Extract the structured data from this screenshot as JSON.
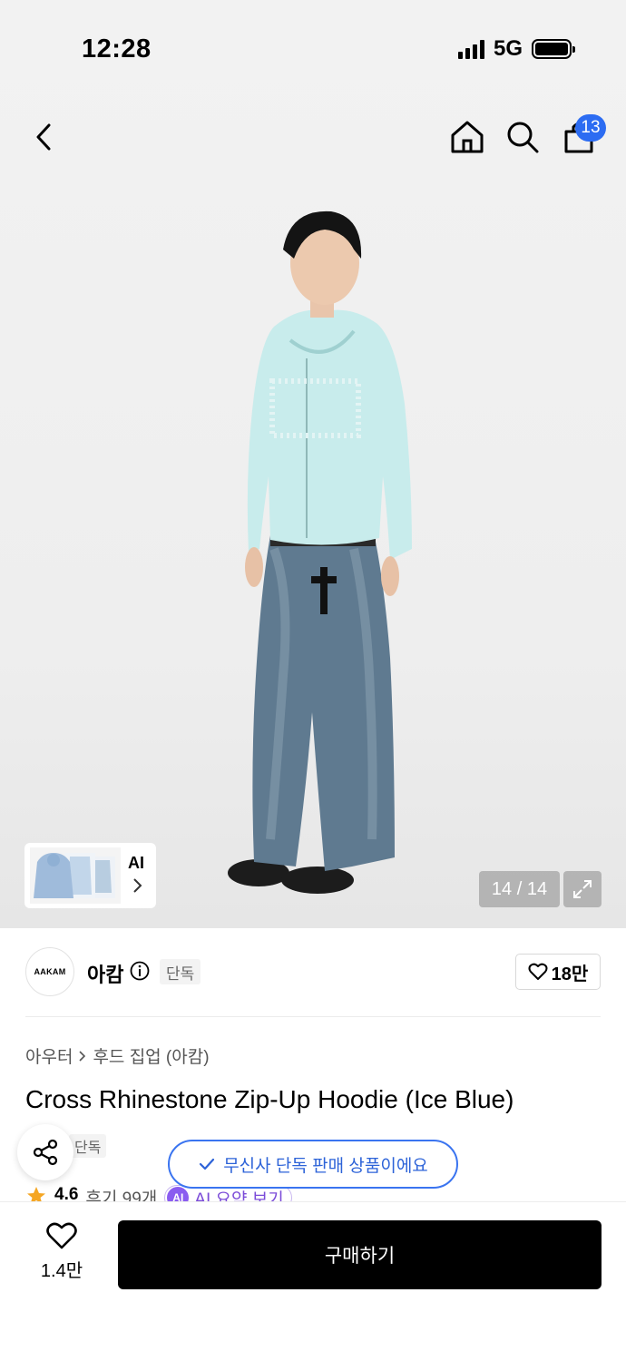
{
  "status_bar": {
    "time": "12:28",
    "network": "5G"
  },
  "header": {
    "cart_count": "13"
  },
  "gallery": {
    "thumbnail_label": "AI",
    "counter": "14 / 14"
  },
  "brand": {
    "logo_text": "AAKAM",
    "name": "아캄",
    "tag": "단독",
    "likes": "18만"
  },
  "product": {
    "breadcrumb": [
      "아우터",
      "후드 집업 (아캄)"
    ],
    "title": "Cross Rhinestone Zip-Up Hoodie (Ice Blue)",
    "exclusive_tag": "단독",
    "exclusive_notice": "무신사 단독 판매 상품이에요",
    "rating": "4.6",
    "reviews": "후기 99개",
    "ai_summary_badge": "AI",
    "ai_summary_label": "AI 요약 보기"
  },
  "bottom": {
    "favorites_count": "1.4만",
    "buy_label": "구매하기"
  },
  "colors": {
    "accent_blue": "#2c6cf2",
    "ai_purple": "#8a5cf0",
    "star": "#f5a623",
    "hoodie": "#c8ecec",
    "denim": "#5d7890"
  }
}
